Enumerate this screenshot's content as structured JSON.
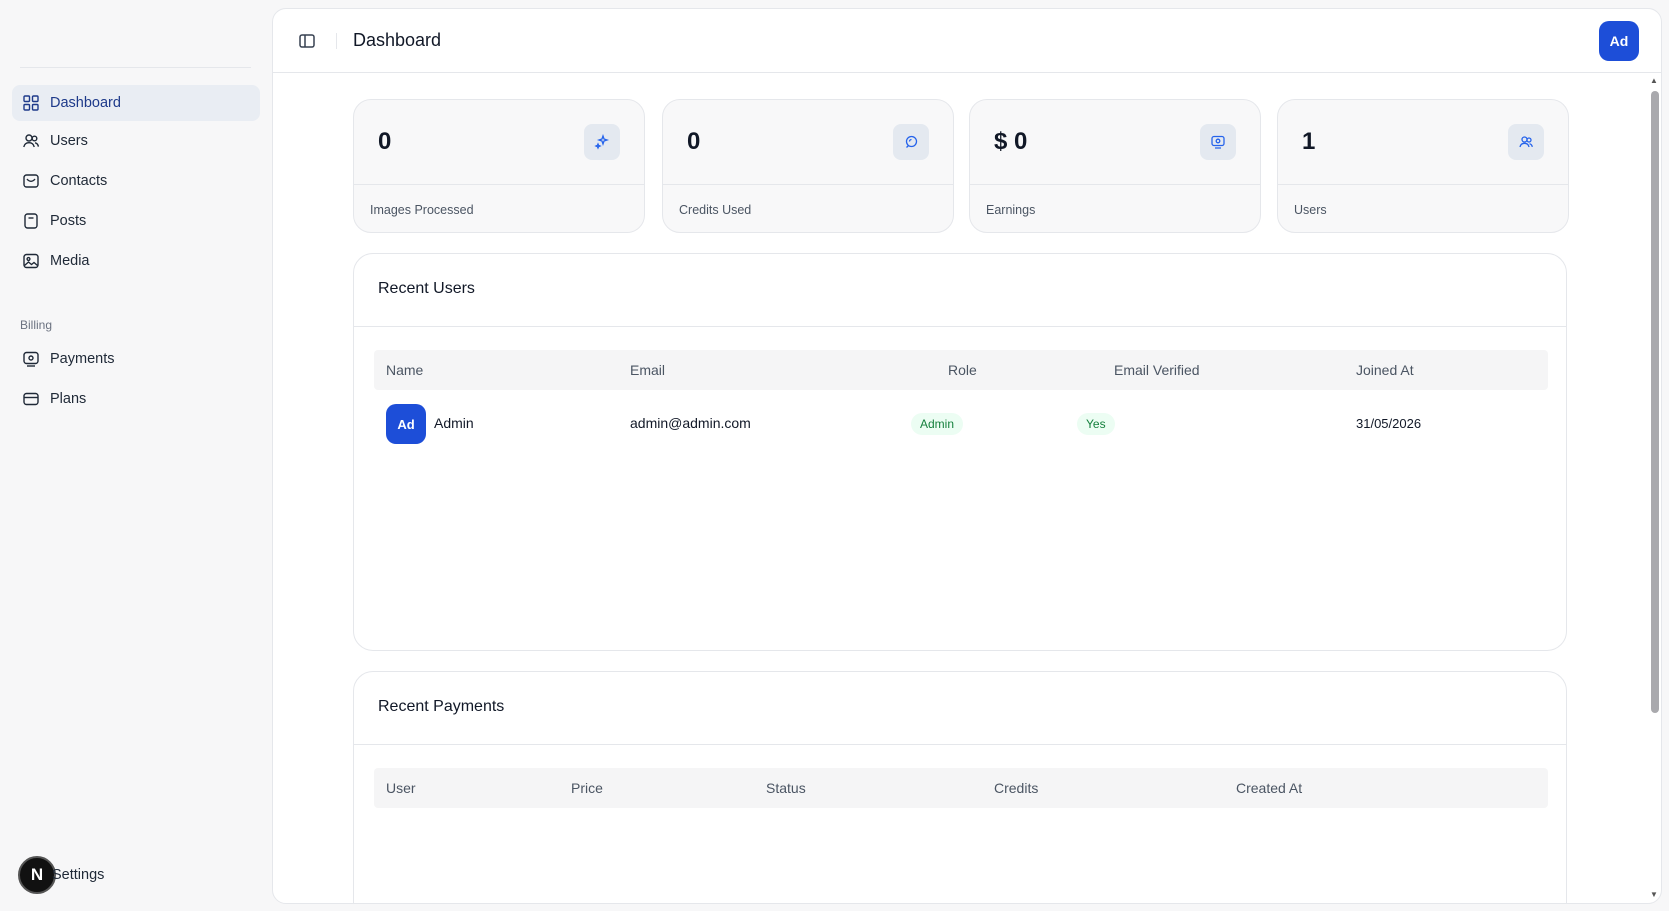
{
  "sidebar": {
    "items": [
      {
        "label": "Dashboard",
        "icon": "grid-icon",
        "active": true
      },
      {
        "label": "Users",
        "icon": "users-icon"
      },
      {
        "label": "Contacts",
        "icon": "contacts-icon"
      },
      {
        "label": "Posts",
        "icon": "posts-icon"
      },
      {
        "label": "Media",
        "icon": "image-icon"
      }
    ],
    "billing_label": "Billing",
    "billing_items": [
      {
        "label": "Payments",
        "icon": "payments-icon"
      },
      {
        "label": "Plans",
        "icon": "card-icon"
      }
    ],
    "settings_label": "Settings",
    "badge_letter": "N"
  },
  "header": {
    "title": "Dashboard",
    "avatar_initials": "Ad"
  },
  "stats": [
    {
      "value": "0",
      "label": "Images Processed",
      "icon": "sparkles-icon"
    },
    {
      "value": "0",
      "label": "Credits Used",
      "icon": "credits-icon"
    },
    {
      "value": "$ 0",
      "label": "Earnings",
      "icon": "money-icon"
    },
    {
      "value": "1",
      "label": "Users",
      "icon": "users-icon"
    }
  ],
  "recent_users": {
    "title": "Recent Users",
    "columns": [
      "Name",
      "Email",
      "Role",
      "Email Verified",
      "Joined At"
    ],
    "rows": [
      {
        "initials": "Ad",
        "name": "Admin",
        "email": "admin@admin.com",
        "role": "Admin",
        "verified": "Yes",
        "joined": "31/05/2026"
      }
    ]
  },
  "recent_payments": {
    "title": "Recent Payments",
    "columns": [
      "User",
      "Price",
      "Status",
      "Credits",
      "Created At"
    ]
  },
  "colors": {
    "accent": "#1d4ed8",
    "active_nav_bg": "#e9edf3",
    "success_bg": "#ecfdf3",
    "success_text": "#15803d"
  }
}
